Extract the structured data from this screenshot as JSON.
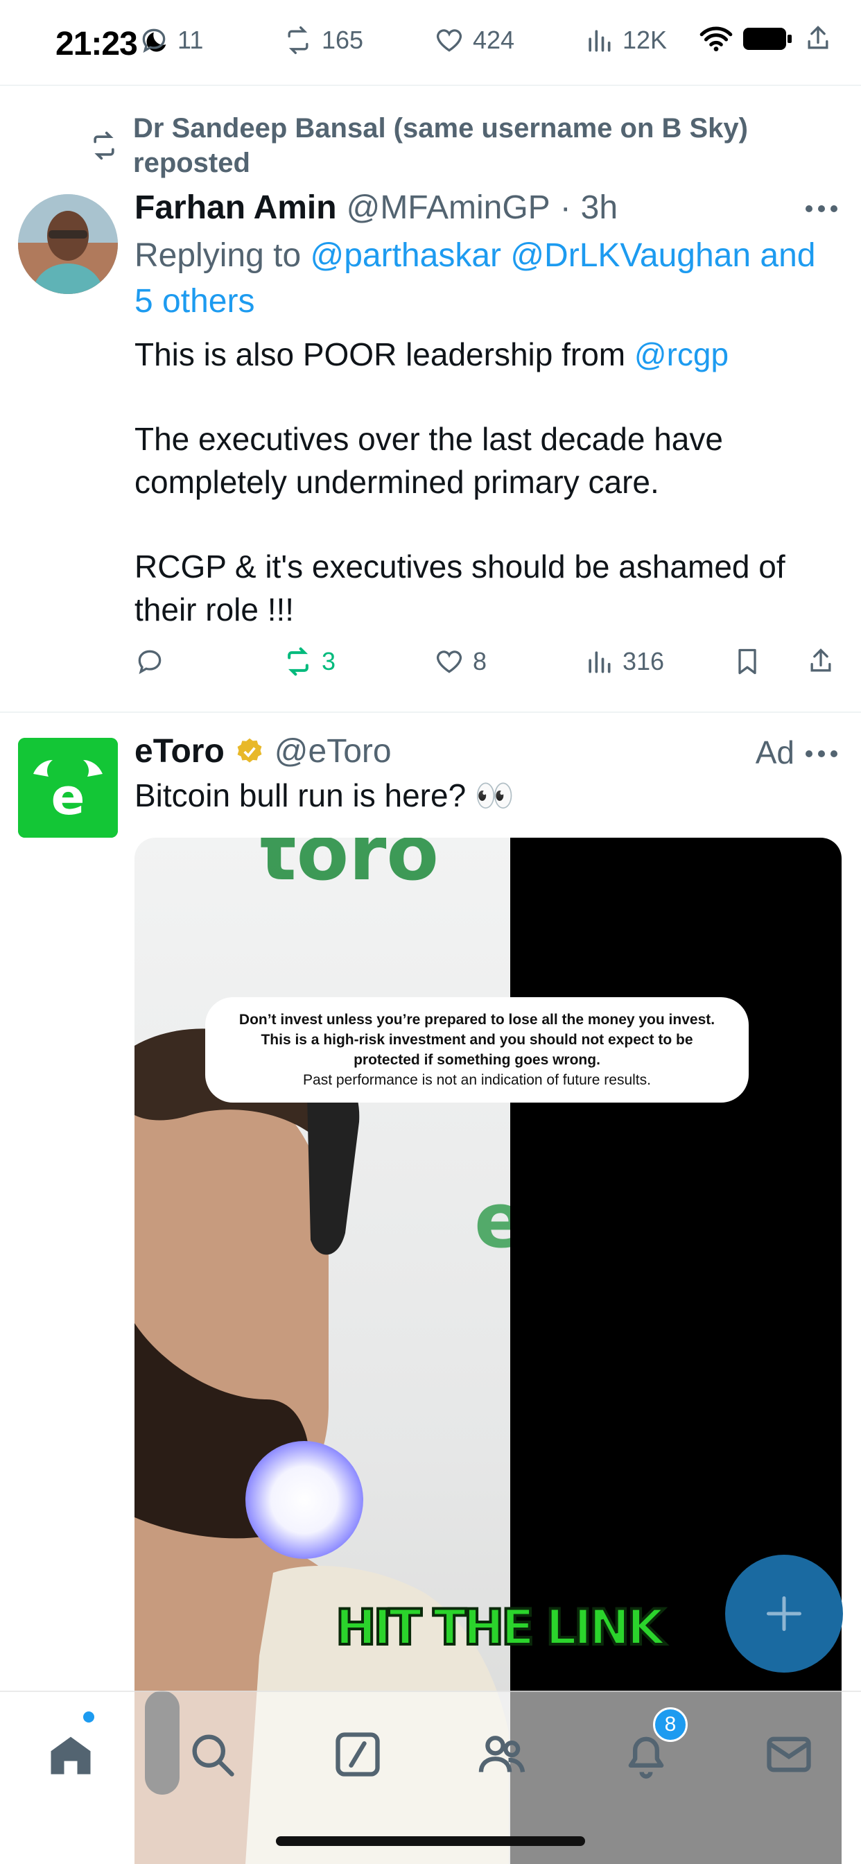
{
  "status_bar": {
    "time": "21:23"
  },
  "prev_tweet_actions": {
    "replies": "11",
    "reposts": "165",
    "likes": "424",
    "views": "12K"
  },
  "tweet1": {
    "repost_by": "Dr Sandeep Bansal (same username on B Sky) reposted",
    "author_name": "Farhan Amin",
    "author_handle": "@MFAminGP",
    "time": "3h",
    "replying_prefix": "Replying to",
    "replying_to": "@parthaskar @DrLKVaughan and 5 others",
    "body_line1_text": "This is also POOR leadership from",
    "body_line1_mention": "@rcgp",
    "body_para2": "The executives over the last decade have completely undermined primary care.",
    "body_para3": "RCGP & it's executives should be ashamed of their role !!!",
    "reposts": "3",
    "likes": "8",
    "views": "316"
  },
  "tweet2": {
    "author_name": "eToro",
    "author_handle": "@eToro",
    "ad_label": "Ad",
    "text": "Bitcoin bull run is here? 👀",
    "disclaimer_bold": "Don’t invest unless you’re prepared to lose all the money you invest. This is a high-risk investment and you should not expect to be protected if something goes wrong.",
    "disclaimer_plain": "Past performance is not an indication of future results.",
    "caption": "HIT THE LINK"
  },
  "nav": {
    "notifications_badge": "8"
  },
  "colors": {
    "link": "#1d9bf0",
    "repost_green": "#00ba7c",
    "etoro_green": "#13c636",
    "fab": "#1a6aa1"
  }
}
